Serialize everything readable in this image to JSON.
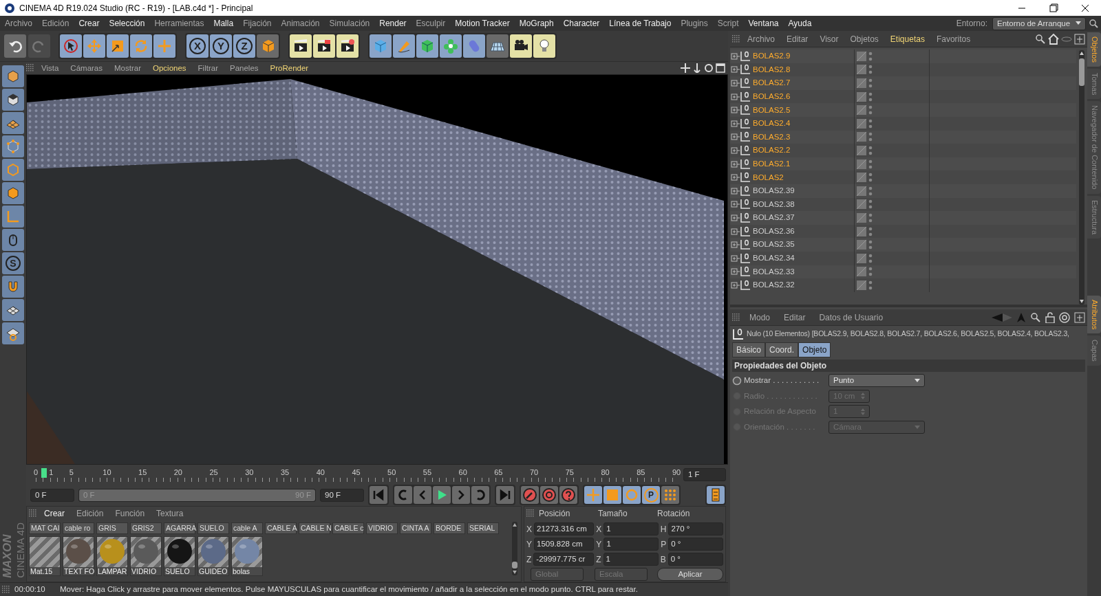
{
  "window": {
    "title": "CINEMA 4D R19.024 Studio (RC - R19) - [LAB.c4d *] - Principal"
  },
  "menu": [
    {
      "label": "Archivo",
      "bright": false
    },
    {
      "label": "Edición",
      "bright": false
    },
    {
      "label": "Crear",
      "bright": true
    },
    {
      "label": "Selección",
      "bright": true
    },
    {
      "label": "Herramientas",
      "bright": false
    },
    {
      "label": "Malla",
      "bright": true
    },
    {
      "label": "Fijación",
      "bright": false
    },
    {
      "label": "Animación",
      "bright": false
    },
    {
      "label": "Simulación",
      "bright": false
    },
    {
      "label": "Render",
      "bright": true
    },
    {
      "label": "Esculpir",
      "bright": false
    },
    {
      "label": "Motion Tracker",
      "bright": true
    },
    {
      "label": "MoGraph",
      "bright": true
    },
    {
      "label": "Character",
      "bright": true
    },
    {
      "label": "Línea de Trabajo",
      "bright": true
    },
    {
      "label": "Plugins",
      "bright": false
    },
    {
      "label": "Script",
      "bright": false
    },
    {
      "label": "Ventana",
      "bright": true
    },
    {
      "label": "Ayuda",
      "bright": true
    }
  ],
  "environment": {
    "label": "Entorno:",
    "value": "Entorno de Arranque"
  },
  "toolbar": {
    "axis_buttons": [
      "X",
      "Y",
      "Z"
    ]
  },
  "left_toolbar": {
    "snap_letter": "S"
  },
  "viewport": {
    "menu": [
      {
        "label": "Vista",
        "bright": false
      },
      {
        "label": "Cámaras",
        "bright": false
      },
      {
        "label": "Mostrar",
        "bright": false
      },
      {
        "label": "Opciones",
        "bright": true
      },
      {
        "label": "Filtrar",
        "bright": false
      },
      {
        "label": "Paneles",
        "bright": false
      },
      {
        "label": "ProRender",
        "bright": true
      }
    ]
  },
  "timeline": {
    "ticks": [
      "0",
      "5",
      "10",
      "15",
      "20",
      "25",
      "30",
      "35",
      "40",
      "45",
      "50",
      "55",
      "60",
      "65",
      "70",
      "75",
      "80",
      "85",
      "90"
    ],
    "current": "1",
    "frame_field": "1 F"
  },
  "transport": {
    "start": "0 F",
    "range": {
      "start": "0 F",
      "end": "90 F",
      "level": 1
    },
    "end": "90 F",
    "param_letter": "P"
  },
  "logo": {
    "brand": "MAXON",
    "product": "CINEMA 4D"
  },
  "materials": {
    "menu": [
      {
        "label": "Crear",
        "bright": true
      },
      {
        "label": "Edición",
        "bright": false
      },
      {
        "label": "Función",
        "bright": false
      },
      {
        "label": "Textura",
        "bright": false
      }
    ],
    "row1": [
      "MAT CAI",
      "cable ro",
      "GRIS",
      "GRIS2",
      "AGARRA",
      "SUELO",
      "cable A",
      "CABLE A",
      "CABLE N",
      "CABLE c",
      "VIDRIO",
      "CINTA A",
      "BORDE",
      "SERIAL"
    ],
    "row2": [
      {
        "label": "Mat.15",
        "kind": "empty"
      },
      {
        "label": "TEXT FO",
        "kind": "sphere",
        "color": "#5b4f48"
      },
      {
        "label": "LAMPAR",
        "kind": "sphere",
        "color": "#b8901c"
      },
      {
        "label": "VIDRIO",
        "kind": "sphere",
        "color": "#5a5a5a"
      },
      {
        "label": "SUELO",
        "kind": "sphere",
        "color": "#151515"
      },
      {
        "label": "GUIDEO",
        "kind": "sphere",
        "color": "#5c6a88"
      },
      {
        "label": "bolas",
        "kind": "sphere",
        "color": "#7486a6"
      }
    ]
  },
  "coordinates": {
    "headers": [
      "Posición",
      "Tamaño",
      "Rotación"
    ],
    "rows": [
      {
        "axis": "X",
        "position": "21273.316 cm",
        "size_axis": "X",
        "size": "1",
        "rot_axis": "H",
        "rotation": "270 °"
      },
      {
        "axis": "Y",
        "position": "1509.828 cm",
        "size_axis": "Y",
        "size": "1",
        "rot_axis": "P",
        "rotation": "0 °"
      },
      {
        "axis": "Z",
        "position": "-29997.775 cr",
        "size_axis": "Z",
        "size": "1",
        "rot_axis": "B",
        "rotation": "0 °"
      }
    ],
    "space": "Global",
    "mode": "Escala",
    "apply": "Aplicar"
  },
  "status_bar": {
    "time": "00:00:10",
    "message": "Mover: Haga Click y arrastre para mover elementos. Pulse MAYUSCULAS para cuantificar el movimiento / añadir a la selección en el modo punto. CTRL para restar."
  },
  "objects": {
    "menu": [
      {
        "label": "Archivo",
        "bright": false
      },
      {
        "label": "Editar",
        "bright": false
      },
      {
        "label": "Visor",
        "bright": false
      },
      {
        "label": "Objetos",
        "bright": false
      },
      {
        "label": "Etiquetas",
        "bright": true
      },
      {
        "label": "Favoritos",
        "bright": false
      }
    ],
    "items": [
      {
        "name": "BOLAS2.9",
        "selected": true
      },
      {
        "name": "BOLAS2.8",
        "selected": true
      },
      {
        "name": "BOLAS2.7",
        "selected": true
      },
      {
        "name": "BOLAS2.6",
        "selected": true
      },
      {
        "name": "BOLAS2.5",
        "selected": true
      },
      {
        "name": "BOLAS2.4",
        "selected": true
      },
      {
        "name": "BOLAS2.3",
        "selected": true
      },
      {
        "name": "BOLAS2.2",
        "selected": true
      },
      {
        "name": "BOLAS2.1",
        "selected": true
      },
      {
        "name": "BOLAS2",
        "selected": true
      },
      {
        "name": "BOLAS2.39",
        "selected": false
      },
      {
        "name": "BOLAS2.38",
        "selected": false
      },
      {
        "name": "BOLAS2.37",
        "selected": false
      },
      {
        "name": "BOLAS2.36",
        "selected": false
      },
      {
        "name": "BOLAS2.35",
        "selected": false
      },
      {
        "name": "BOLAS2.34",
        "selected": false
      },
      {
        "name": "BOLAS2.33",
        "selected": false
      },
      {
        "name": "BOLAS2.32",
        "selected": false
      }
    ]
  },
  "side_tabs_top": [
    {
      "label": "Objetos",
      "selected": true
    },
    {
      "label": "Tomas",
      "selected": false
    },
    {
      "label": "Navegador de Contenido",
      "selected": false
    },
    {
      "label": "Estructura",
      "selected": false
    }
  ],
  "attributes": {
    "menu": [
      "Modo",
      "Editar",
      "Datos de Usuario"
    ],
    "summary": "Nulo (10 Elementos) [BOLAS2.9, BOLAS2.8, BOLAS2.7, BOLAS2.6, BOLAS2.5, BOLAS2.4, BOLAS2.3,",
    "tabs": [
      {
        "label": "Básico",
        "selected": false
      },
      {
        "label": "Coord.",
        "selected": false
      },
      {
        "label": "Objeto",
        "selected": true
      }
    ],
    "section": "Propiedades del Objeto",
    "fields": [
      {
        "label": "Mostrar . . . . . . . . . . .",
        "kind": "dropdown",
        "value": "Punto",
        "disabled": false
      },
      {
        "label": "Radio . . . . . . . . . . . .",
        "kind": "number",
        "value": "10 cm",
        "disabled": true
      },
      {
        "label": "Relación de Aspecto",
        "kind": "number",
        "value": "1",
        "disabled": true
      },
      {
        "label": "Orientación . . . . . . .",
        "kind": "dropdown",
        "value": "Cámara",
        "disabled": true
      }
    ]
  },
  "side_tabs_bottom": [
    {
      "label": "Atributos",
      "selected": true
    },
    {
      "label": "Capas",
      "selected": false
    }
  ]
}
